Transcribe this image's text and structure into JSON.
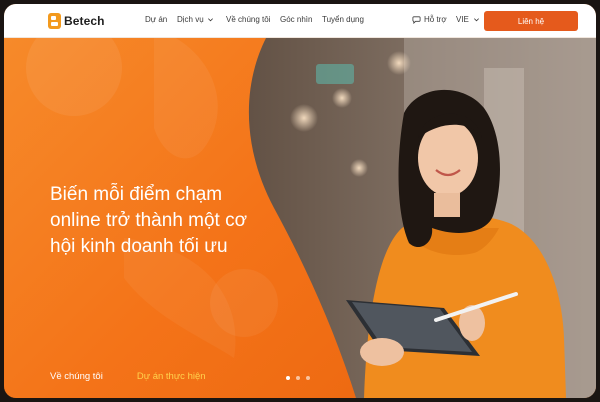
{
  "brand": {
    "name": "Betech",
    "logo_icon": "betech-logo-icon",
    "accent": "#e55a1c",
    "hero_orange": "#f47a1c"
  },
  "nav": {
    "items": [
      {
        "label": "Dự án",
        "has_dropdown": false
      },
      {
        "label": "Dịch vụ",
        "has_dropdown": true
      },
      {
        "label": "Về chúng tôi",
        "has_dropdown": false
      },
      {
        "label": "Góc nhìn",
        "has_dropdown": false
      },
      {
        "label": "Tuyển dụng",
        "has_dropdown": false
      }
    ],
    "support_label": "Hỗ trợ",
    "support_icon": "support-chat-icon",
    "language": "VIE",
    "contact_label": "Liên hệ"
  },
  "hero": {
    "title_lines": [
      "Biến mỗi điểm chạm",
      "online trở thành một cơ",
      "hội kinh doanh tối ưu"
    ],
    "links": {
      "about": "Về chúng tôi",
      "projects": "Dự án thực hiện"
    },
    "slider": {
      "total": 3,
      "active": 1
    }
  }
}
